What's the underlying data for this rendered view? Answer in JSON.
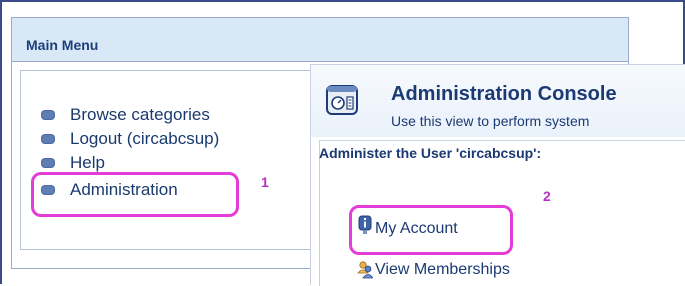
{
  "main_menu": {
    "title": "Main Menu",
    "items": [
      {
        "label": "Browse categories"
      },
      {
        "label": "Logout (circabcsup)"
      },
      {
        "label": "Help"
      },
      {
        "label": "Administration"
      }
    ]
  },
  "console": {
    "title": "Administration Console",
    "description": "Use this view to perform system",
    "administer_label": "Administer the User 'circabcsup':",
    "links": [
      {
        "label": "My Account",
        "icon": "info-icon"
      },
      {
        "label": "View Memberships",
        "icon": "users-icon"
      }
    ]
  },
  "annotations": {
    "marker_1": "1",
    "marker_2": "2",
    "highlight_color": "#e43cd8"
  }
}
